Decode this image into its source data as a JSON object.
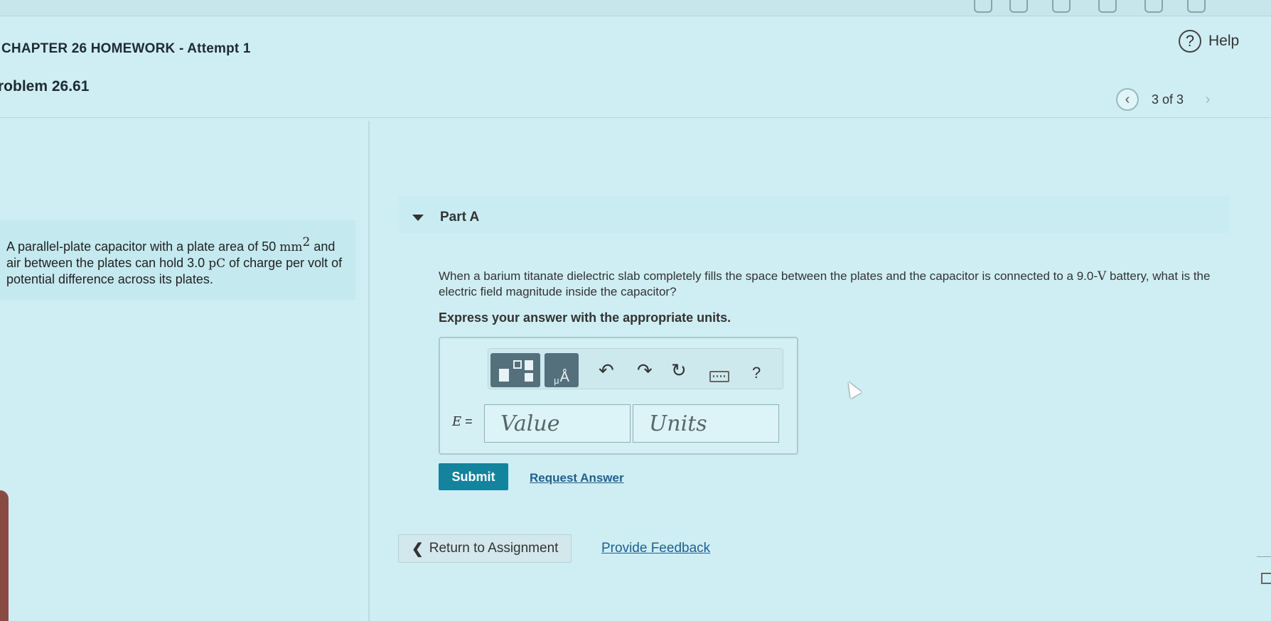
{
  "header": {
    "chapter_title": "CHAPTER 26 HOMEWORK",
    "attempt": " - Attempt 1",
    "problem": "roblem 26.61",
    "help_label": "Help",
    "help_icon": "?",
    "pager_text": "3 of 3",
    "prev_glyph": "‹",
    "next_glyph": "›"
  },
  "problem_statement": {
    "t1": "A parallel-plate capacitor with a plate area of 50 ",
    "area_unit": "mm",
    "area_exp": "2",
    "t2": " and air between the plates can hold 3.0 ",
    "charge_unit": "pC",
    "t3": " of charge per volt of potential difference across its plates."
  },
  "part": {
    "label": "Part A",
    "question_1": "When a barium titanate dielectric slab completely fills the space between the plates and the capacitor is connected to a 9.0-",
    "volt_unit": "V",
    "question_2": " battery, what is the electric field magnitude inside the capacitor?",
    "instruction": "Express your answer with the appropriate units."
  },
  "answer": {
    "variable": "E",
    "equals": " =",
    "value_placeholder": "Value",
    "units_placeholder": "Units"
  },
  "toolbar": {
    "units_mu": "μ",
    "units_a": "Å",
    "undo": "↶",
    "redo": "↷",
    "reset": "↻",
    "help": "?"
  },
  "actions": {
    "submit": "Submit",
    "request_answer": "Request Answer",
    "return_chevron": "❮",
    "return_label": "Return to Assignment",
    "feedback": "Provide Feedback"
  },
  "icons": [
    "help-circle-icon",
    "chevron-left-icon",
    "chevron-right-icon",
    "caret-down-icon",
    "templates-icon",
    "units-icon",
    "undo-icon",
    "redo-icon",
    "reset-icon",
    "keyboard-icon",
    "question-icon",
    "mouse-cursor-icon"
  ],
  "colors": {
    "background": "#cfeef3",
    "submit_button": "#13839e",
    "link": "#1f5f8f",
    "toolbar_button": "#55707d"
  }
}
